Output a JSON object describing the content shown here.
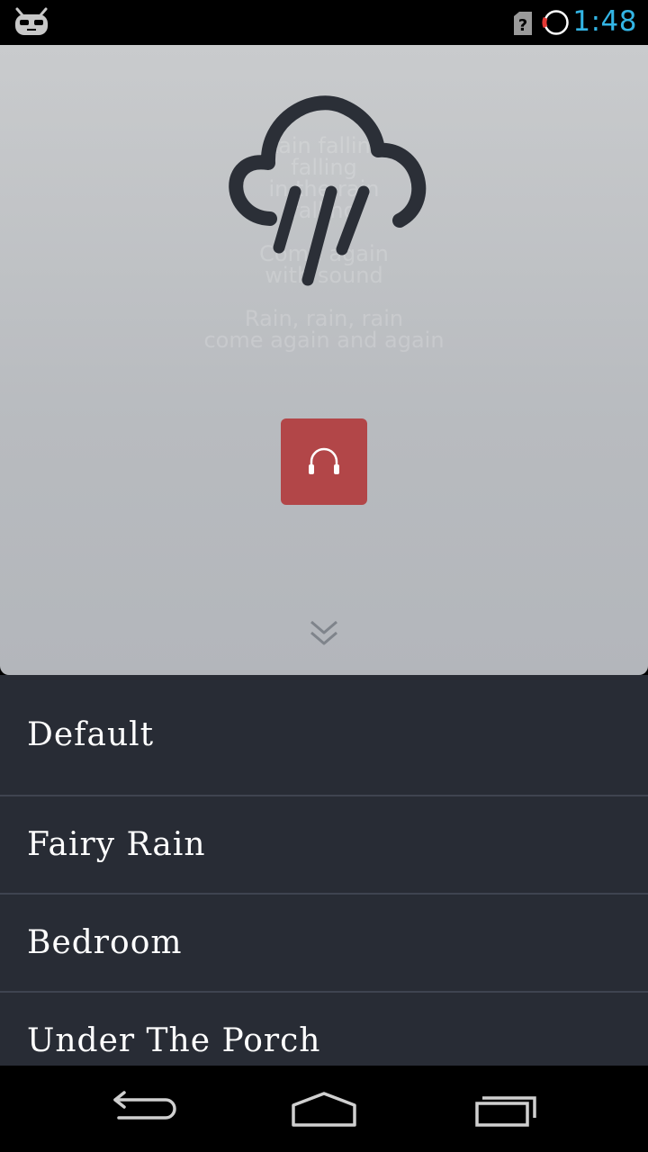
{
  "status_bar": {
    "time": "1:48",
    "time_color": "#33b5e5",
    "icons": [
      "cyanogenmod-robot-icon",
      "sim-unknown-icon",
      "battery-low-icon"
    ]
  },
  "player": {
    "background_lyrics": [
      [
        "Rain falling",
        "falling",
        "in the rain",
        "falling"
      ],
      [
        "Come again",
        "with sound"
      ],
      [
        "Rain, rain, rain",
        "come again and again"
      ]
    ],
    "icon": "rain-cloud-icon",
    "listen_button_icon": "headphones-icon",
    "listen_button_color": "#b24648",
    "expand_icon": "double-chevron-down-icon"
  },
  "sounds": {
    "items": [
      {
        "label": "Default"
      },
      {
        "label": "Fairy Rain"
      },
      {
        "label": "Bedroom"
      },
      {
        "label": "Under The Porch"
      }
    ]
  },
  "nav_bar": {
    "buttons": [
      "back-icon",
      "home-icon",
      "recent-apps-icon"
    ]
  }
}
